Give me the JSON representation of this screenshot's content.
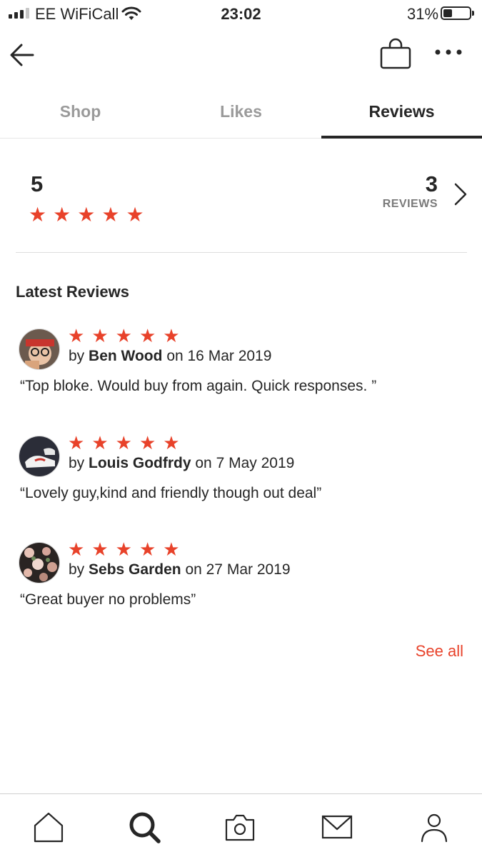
{
  "status_bar": {
    "carrier": "EE WiFiCall",
    "time": "23:02",
    "battery": "31%",
    "battery_level": 0.31
  },
  "header": {
    "back_icon": "back-arrow-icon",
    "bag_icon": "shopping-bag-icon",
    "more_icon": "more-dots-icon"
  },
  "tabs": [
    {
      "label": "Shop",
      "active": false
    },
    {
      "label": "Likes",
      "active": false
    },
    {
      "label": "Reviews",
      "active": true
    }
  ],
  "summary": {
    "score": "5",
    "stars": 5,
    "count": "3",
    "count_label": "REVIEWS"
  },
  "latest": {
    "title": "Latest Reviews",
    "reviews": [
      {
        "by": "by",
        "name": "Ben Wood",
        "on": "on 16 Mar 2019",
        "text": "“Top bloke. Would buy from again. Quick responses. ”",
        "stars": 5
      },
      {
        "by": "by",
        "name": "Louis Godfrdy",
        "on": "on 7 May 2019",
        "text": "“Lovely guy,kind and friendly though out deal”",
        "stars": 5
      },
      {
        "by": "by",
        "name": "Sebs Garden",
        "on": "on 27 Mar 2019",
        "text": "“Great buyer no problems”",
        "stars": 5
      }
    ],
    "see_all": "See all"
  },
  "colors": {
    "accent": "#e8422a",
    "text": "#262626",
    "muted": "#9a9a9a"
  },
  "bottom_nav": [
    "home-icon",
    "search-icon",
    "camera-icon",
    "mail-icon",
    "profile-icon"
  ]
}
